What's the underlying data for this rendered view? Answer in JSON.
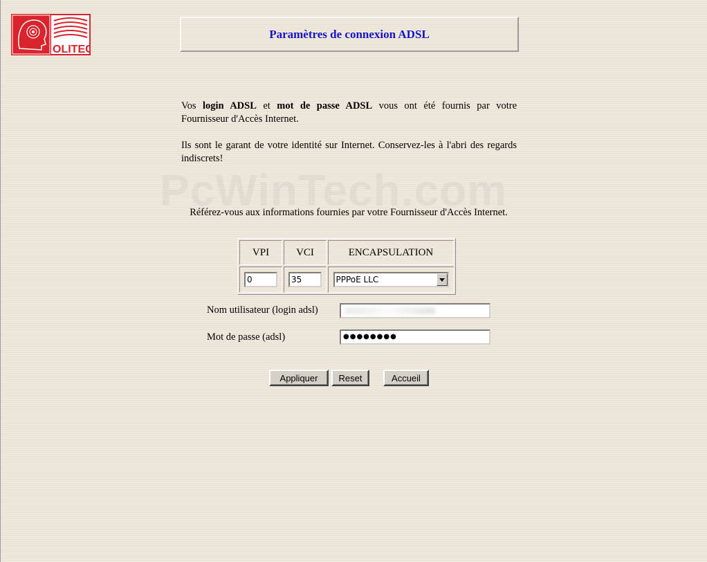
{
  "header": {
    "logo_text": "OLITEC",
    "title": "Paramètres de connexion ADSL"
  },
  "intro": {
    "p1_a": "Vos ",
    "p1_b": "login ADSL",
    "p1_c": " et ",
    "p1_d": "mot de passe ADSL",
    "p1_e": " vous ont été fournis par votre",
    "p1_f": "Fournisseur d'Accès Internet.",
    "p2": "Ils sont le garant de votre identité sur Internet. Conservez-les à l'abri des regards indiscrets!"
  },
  "watermark": "PcWinTech.com",
  "reference": "Référez-vous aux informations fournies par votre Fournisseur d'Accès Internet.",
  "params": {
    "vpi_header": "VPI",
    "vci_header": "VCI",
    "encapsulation_header": "ENCAPSULATION",
    "vpi_value": "0",
    "vci_value": "35",
    "encapsulation_value": "PPPoE LLC"
  },
  "credentials": {
    "username_label": "Nom utilisateur (login adsl)",
    "password_label": "Mot de passe (adsl)",
    "password_value": "●●●●●●●●"
  },
  "buttons": {
    "apply": "Appliquer",
    "reset": "Reset",
    "home": "Accueil"
  },
  "colors": {
    "title": "#1515c8",
    "logo_red": "#d9232d"
  },
  "icons": {
    "dropdown": "chevron-down-icon"
  }
}
